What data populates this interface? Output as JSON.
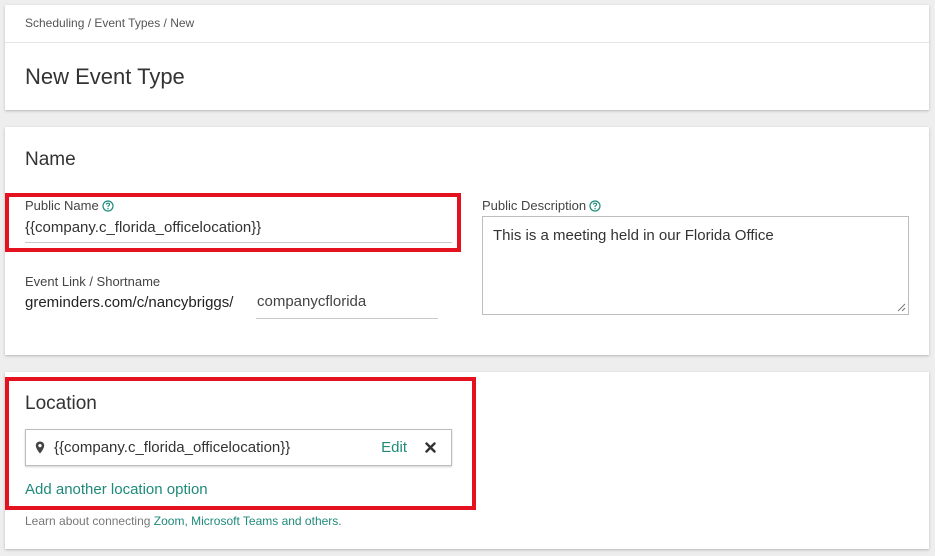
{
  "header": {
    "breadcrumb": "Scheduling / Event Types / New",
    "title": "New Event Type"
  },
  "name_section": {
    "title": "Name",
    "public_name_label": "Public Name",
    "public_name_value": "{{company.c_florida_officelocation}}",
    "public_description_label": "Public Description",
    "public_description_value": "This is a meeting held in our Florida Office",
    "event_link_label": "Event Link / Shortname",
    "event_link_prefix": "greminders.com/c/nancybriggs/",
    "event_link_value": "companycflorida"
  },
  "location_section": {
    "title": "Location",
    "location_value": "{{company.c_florida_officelocation}}",
    "edit_label": "Edit",
    "add_location_label": "Add another location option",
    "learn_prefix": "Learn about connecting ",
    "learn_link": "Zoom, Microsoft Teams and others."
  },
  "icons": {
    "help": "help-circle-icon",
    "pin": "map-pin-icon",
    "remove": "close-x-icon"
  },
  "colors": {
    "accent": "#1e8a7a",
    "highlight": "#e3121e",
    "background": "#eeeeee"
  }
}
